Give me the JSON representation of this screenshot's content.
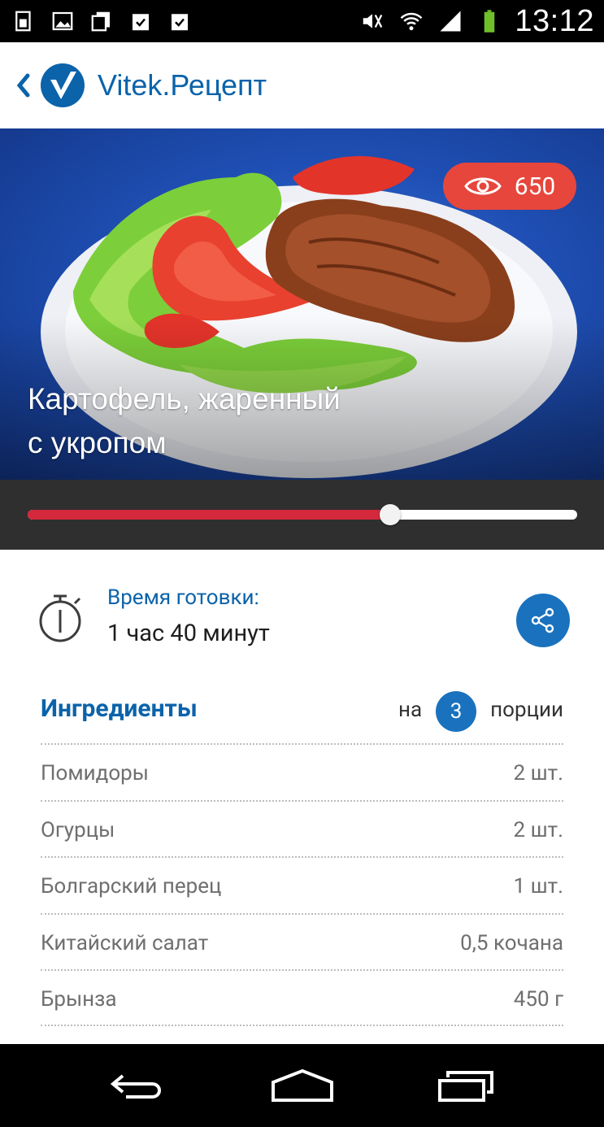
{
  "status_bar": {
    "time": "13:12"
  },
  "app_bar": {
    "title": "Vitek.Рецепт"
  },
  "recipe": {
    "title_line1": "Картофель, жаренный",
    "title_line2": "с укропом",
    "views": "650",
    "slider_progress": 0.66
  },
  "cook_time": {
    "label": "Время готовки:",
    "value": "1 час 40 минут"
  },
  "ingredients": {
    "title": "Ингредиенты",
    "for_label": "на",
    "portions_count": "3",
    "portions_label": "порции",
    "items": [
      {
        "name": "Помидоры",
        "amount": "2 шт."
      },
      {
        "name": "Огурцы",
        "amount": "2 шт."
      },
      {
        "name": "Болгарский перец",
        "amount": "1 шт."
      },
      {
        "name": "Китайский салат",
        "amount": "0,5 кочана"
      },
      {
        "name": "Брынза",
        "amount": "450 г"
      }
    ]
  },
  "colors": {
    "accent": "#0b63aa",
    "badge": "#e6463c",
    "slider_fill": "#d4283c"
  }
}
